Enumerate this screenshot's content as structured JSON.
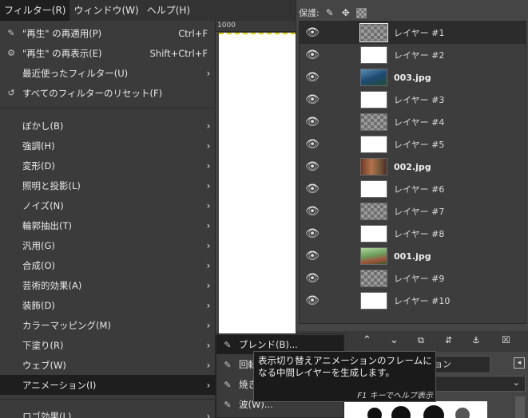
{
  "menubar": {
    "items": [
      {
        "label": "フィルター(R)",
        "active": true
      },
      {
        "label": "ウィンドウ(W)",
        "active": false
      },
      {
        "label": "ヘルプ(H)",
        "active": false
      }
    ]
  },
  "canvas": {
    "ruler_label": "1000"
  },
  "filters_menu": {
    "reapply": {
      "label": "\"再生\" の再適用(P)",
      "shortcut": "Ctrl+F"
    },
    "reshow": {
      "label": "\"再生\" の再表示(E)",
      "shortcut": "Shift+Ctrl+F"
    },
    "recent": {
      "label": "最近使ったフィルター(U)"
    },
    "reset": {
      "label": "すべてのフィルターのリセット(F)"
    },
    "categories": [
      "ぼかし(B)",
      "強調(H)",
      "変形(D)",
      "照明と投影(L)",
      "ノイズ(N)",
      "輪郭抽出(T)",
      "汎用(G)",
      "合成(O)",
      "芸術的効果(A)",
      "装飾(D)",
      "カラーマッピング(M)",
      "下塗り(R)",
      "ウェブ(W)",
      "アニメーション(I)"
    ],
    "bottom_item": "ロゴ効果(L)"
  },
  "animation_submenu": {
    "items": [
      "ブレンド(B)...",
      "回転...",
      "焼き...",
      "波(W)..."
    ]
  },
  "tooltip": {
    "text": "表示切り替えアニメーションのフレームになる中間レイヤーを生成します。",
    "help": "F1 キーでヘルプ表示"
  },
  "layers_panel": {
    "lock_label": "保護:",
    "layers": [
      {
        "name": "レイヤー #1",
        "thumb": "checker",
        "bold": false,
        "selected": true
      },
      {
        "name": "レイヤー #2",
        "thumb": "white",
        "bold": false,
        "selected": false
      },
      {
        "name": "003.jpg",
        "thumb": "photo",
        "bold": true,
        "selected": false
      },
      {
        "name": "レイヤー #3",
        "thumb": "white",
        "bold": false,
        "selected": false
      },
      {
        "name": "レイヤー #4",
        "thumb": "checker",
        "bold": false,
        "selected": false
      },
      {
        "name": "レイヤー #5",
        "thumb": "white",
        "bold": false,
        "selected": false
      },
      {
        "name": "002.jpg",
        "thumb": "photo2",
        "bold": true,
        "selected": false
      },
      {
        "name": "レイヤー #6",
        "thumb": "white",
        "bold": false,
        "selected": false
      },
      {
        "name": "レイヤー #7",
        "thumb": "checker",
        "bold": false,
        "selected": false
      },
      {
        "name": "レイヤー #8",
        "thumb": "white",
        "bold": false,
        "selected": false
      },
      {
        "name": "001.jpg",
        "thumb": "photo3",
        "bold": true,
        "selected": false
      },
      {
        "name": "レイヤー #9",
        "thumb": "checker",
        "bold": false,
        "selected": false
      },
      {
        "name": "レイヤー #10",
        "thumb": "white",
        "bold": false,
        "selected": false
      }
    ]
  },
  "dock": {
    "tab_label": "ーション"
  },
  "colors": {
    "menu_bg": "#3b3b3b",
    "selected_bg": "#1e1e1e",
    "panel_bg": "#454545"
  }
}
